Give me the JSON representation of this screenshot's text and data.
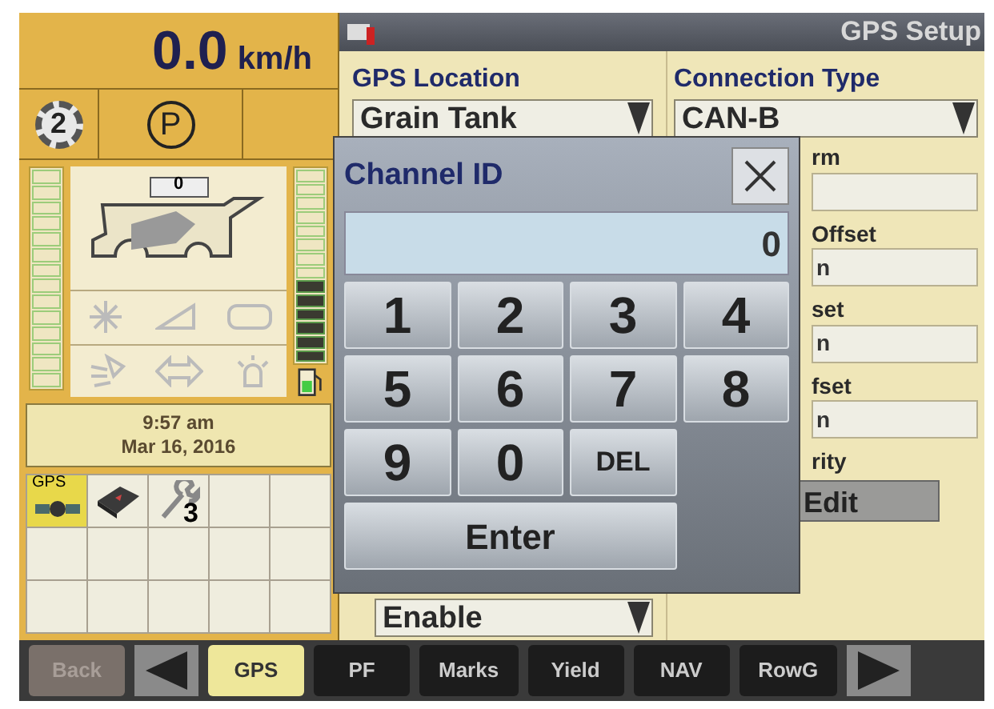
{
  "speed": {
    "value": "0.0",
    "unit": "km/h"
  },
  "gear": "2",
  "park": "P",
  "header_counter": "0",
  "fuel_gauge": {
    "level": 0.45
  },
  "clock": {
    "time": "9:57 am",
    "date": "Mar 16, 2016"
  },
  "shortcuts": [
    {
      "kind": "gps",
      "label": "GPS",
      "selected": true
    },
    {
      "kind": "book",
      "selected": false
    },
    {
      "kind": "wrench",
      "badge": "3",
      "selected": false
    }
  ],
  "title": "GPS Setup",
  "gps_location": {
    "label": "GPS Location",
    "value": "Grain Tank"
  },
  "connection_type": {
    "label": "Connection Type",
    "value": "CAN-B"
  },
  "partial_rows": [
    {
      "label": "rm",
      "value": ""
    },
    {
      "label": "Offset",
      "value": "n"
    },
    {
      "label": "set",
      "value": "n"
    },
    {
      "label": "fset",
      "value": "n"
    }
  ],
  "partial_label": "rity",
  "edit_button": "Edit",
  "enable_field": "Enable",
  "dialog": {
    "title": "Channel ID",
    "value": "0",
    "keys": [
      {
        "kind": "key",
        "label": "1"
      },
      {
        "kind": "key",
        "label": "2"
      },
      {
        "kind": "key",
        "label": "3"
      },
      {
        "kind": "key",
        "label": "4"
      },
      {
        "kind": "key",
        "label": "5"
      },
      {
        "kind": "key",
        "label": "6"
      },
      {
        "kind": "key",
        "label": "7"
      },
      {
        "kind": "key",
        "label": "8"
      },
      {
        "kind": "key",
        "label": "9"
      },
      {
        "kind": "key",
        "label": "0"
      },
      {
        "kind": "del",
        "label": "DEL"
      },
      {
        "kind": "enter",
        "label": "Enter"
      }
    ]
  },
  "bottom_bar": [
    {
      "kind": "text",
      "label": "Back",
      "disabled": true,
      "selected": false
    },
    {
      "kind": "prev",
      "selected": false
    },
    {
      "kind": "text",
      "label": "GPS",
      "selected": true
    },
    {
      "kind": "text",
      "label": "PF",
      "selected": false
    },
    {
      "kind": "text",
      "label": "Marks",
      "selected": false
    },
    {
      "kind": "text",
      "label": "Yield",
      "selected": false
    },
    {
      "kind": "text",
      "label": "NAV",
      "selected": false
    },
    {
      "kind": "text",
      "label": "RowG",
      "selected": false
    },
    {
      "kind": "next",
      "selected": false
    }
  ]
}
